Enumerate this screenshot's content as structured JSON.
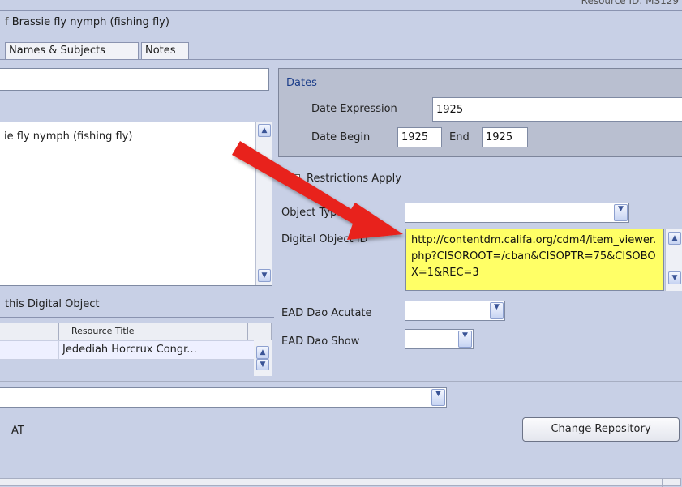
{
  "header": {
    "resource_id_text": "Resource ID: MS129",
    "title": "Brassie fly nymph (fishing fly)"
  },
  "tabs": [
    {
      "label": "Names & Subjects"
    },
    {
      "label": "Notes"
    }
  ],
  "left": {
    "title_field_value": "",
    "title_textarea_value": "ie fly nymph (fishing fly)",
    "linked_section_label": "this Digital Object",
    "table": {
      "column_header": "Resource Title",
      "rows": [
        {
          "title": "Jedediah Horcrux Congr..."
        }
      ]
    }
  },
  "dates": {
    "legend": "Dates",
    "expression_label": "Date Expression",
    "expression_value": "1925",
    "begin_label": "Date Begin",
    "begin_value": "1925",
    "end_label": "End",
    "end_value": "1925"
  },
  "right": {
    "restrictions_label": "Restrictions Apply",
    "restrictions_checked": false,
    "object_type_label": "Object Typ",
    "object_type_value": "",
    "digital_object_id_label": "Digital Object ID",
    "digital_object_id_value": "http://contentdm.califa.org/cdm4/item_viewer.php?CISOROOT=/cban&CISOPTR=75&CISOBOX=1&REC=3",
    "ead_actuate_label": "EAD Dao Acutate",
    "ead_actuate_value": "",
    "ead_show_label": "EAD Dao Show",
    "ead_show_value": ""
  },
  "bottom": {
    "repository_select_value": "",
    "repository_name": "AT",
    "change_repository_label": "Change Repository"
  },
  "annotation": {
    "arrow_color": "#e8221b"
  },
  "colors": {
    "panel_bg": "#c8d0e6",
    "highlight_yellow": "#ffff66",
    "dates_legend": "#1c3e8a"
  }
}
